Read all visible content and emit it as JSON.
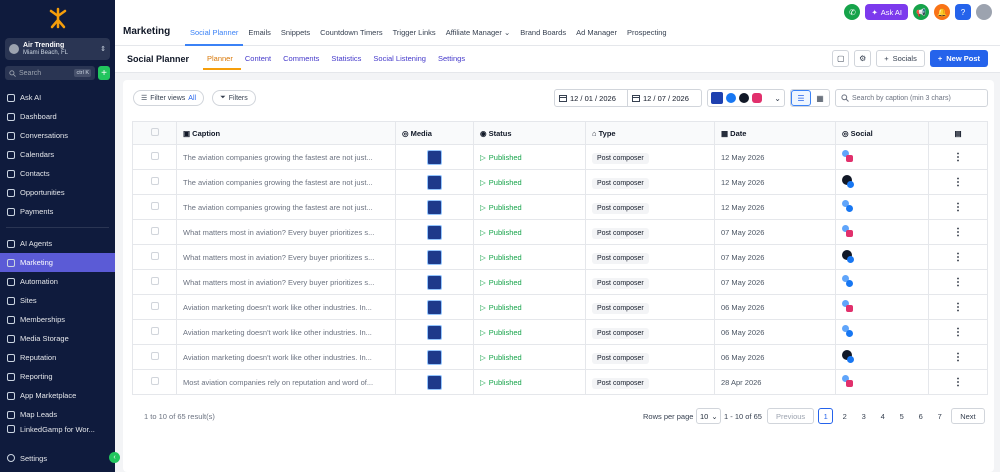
{
  "sidebar": {
    "location_name": "Air Trending",
    "location_sub": "Miami Beach, FL",
    "search_placeholder": "Search",
    "search_shortcut": "ctrl K",
    "items_top": [
      "Ask AI",
      "Dashboard",
      "Conversations",
      "Calendars",
      "Contacts",
      "Opportunities",
      "Payments"
    ],
    "items_bottom": [
      "AI Agents",
      "Marketing",
      "Automation",
      "Sites",
      "Memberships",
      "Media Storage",
      "Reputation",
      "Reporting",
      "App Marketplace",
      "Map Leads",
      "LinkedGamp for Wor..."
    ],
    "settings": "Settings"
  },
  "topbar": {
    "title": "Marketing",
    "tabs": [
      "Social Planner",
      "Emails",
      "Snippets",
      "Countdown Timers",
      "Trigger Links",
      "Affiliate Manager",
      "Brand Boards",
      "Ad Manager",
      "Prospecting"
    ],
    "ask_ai": "Ask AI",
    "help": "?"
  },
  "subbar": {
    "title": "Social Planner",
    "tabs": [
      "Planner",
      "Content",
      "Comments",
      "Statistics",
      "Social Listening",
      "Settings"
    ],
    "socials_label": "Socials",
    "new_post_label": "New Post"
  },
  "filters": {
    "filter_views": "Filter views",
    "filter_views_value": "All",
    "filters": "Filters",
    "date_from": "12 / 01 / 2026",
    "date_to": "12 / 07 / 2026",
    "search_placeholder": "Search by caption (min 3 chars)"
  },
  "table": {
    "headers": [
      "Caption",
      "Media",
      "Status",
      "Type",
      "Date",
      "Social"
    ],
    "rows": [
      {
        "caption": "The aviation companies growing the fastest are not just...",
        "status": "Published",
        "type": "Post composer",
        "date": "12 May 2026",
        "social": "fb-ig"
      },
      {
        "caption": "The aviation companies growing the fastest are not just...",
        "status": "Published",
        "type": "Post composer",
        "date": "12 May 2026",
        "social": "avatar-fb"
      },
      {
        "caption": "The aviation companies growing the fastest are not just...",
        "status": "Published",
        "type": "Post composer",
        "date": "12 May 2026",
        "social": "fb"
      },
      {
        "caption": "What matters most in aviation? Every buyer prioritizes s...",
        "status": "Published",
        "type": "Post composer",
        "date": "07 May 2026",
        "social": "fb-ig"
      },
      {
        "caption": "What matters most in aviation? Every buyer prioritizes s...",
        "status": "Published",
        "type": "Post composer",
        "date": "07 May 2026",
        "social": "avatar-fb"
      },
      {
        "caption": "What matters most in aviation? Every buyer prioritizes s...",
        "status": "Published",
        "type": "Post composer",
        "date": "07 May 2026",
        "social": "fb"
      },
      {
        "caption": "Aviation marketing doesn't work like other industries. In...",
        "status": "Published",
        "type": "Post composer",
        "date": "06 May 2026",
        "social": "fb-ig"
      },
      {
        "caption": "Aviation marketing doesn't work like other industries. In...",
        "status": "Published",
        "type": "Post composer",
        "date": "06 May 2026",
        "social": "fb"
      },
      {
        "caption": "Aviation marketing doesn't work like other industries. In...",
        "status": "Published",
        "type": "Post composer",
        "date": "06 May 2026",
        "social": "avatar-fb"
      },
      {
        "caption": "Most aviation companies rely on reputation and word of...",
        "status": "Published",
        "type": "Post composer",
        "date": "28 Apr 2026",
        "social": "fb-ig"
      }
    ]
  },
  "footer": {
    "results": "1 to 10 of 65 result(s)",
    "rows_per_page_label": "Rows per page",
    "rows_per_page": "10",
    "range": "1 - 10 of 65",
    "previous": "Previous",
    "pages": [
      "1",
      "2",
      "3",
      "4",
      "5",
      "6",
      "7"
    ],
    "next": "Next"
  },
  "colors": {
    "sidebar_bg": "#0f1b3d",
    "active_nav": "#5b5bd6",
    "primary": "#2563eb",
    "published": "#16a34a",
    "active_subtab": "#f59e0b"
  }
}
